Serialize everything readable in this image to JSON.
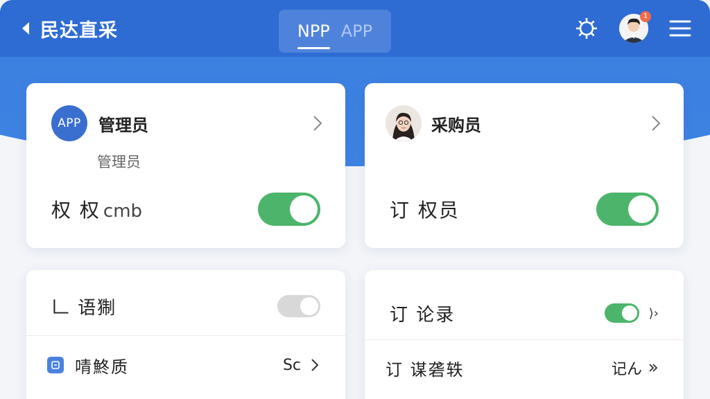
{
  "header": {
    "back_title": "民达直采",
    "tabs": [
      {
        "label": "NPP",
        "active": true
      },
      {
        "label": "APP",
        "active": false
      }
    ],
    "notification_count": "1"
  },
  "cards": {
    "admin": {
      "avatar_text": "APP",
      "name": "管理员",
      "subtitle": "管理员",
      "toggle_label": "权 权",
      "toggle_label_latin": "cmb",
      "toggle_on": true
    },
    "buyer": {
      "name": "采购员",
      "toggle_label": "订 权员",
      "toggle_on": true
    },
    "left_list": {
      "top_label": "𠃊 语猘",
      "top_toggle_on": false,
      "row_label": "啨鮗质",
      "row_value": "Sc"
    },
    "right_list": {
      "top_label": "订 论录",
      "top_toggle_on": true,
      "top_extra": "⟩›",
      "row_label": "订 谋砻轶",
      "row_value": "记ん"
    }
  },
  "colors": {
    "header_blue": "#2e6cd4",
    "toggle_green": "#4cb56b",
    "toggle_off": "#d8d8d8"
  }
}
